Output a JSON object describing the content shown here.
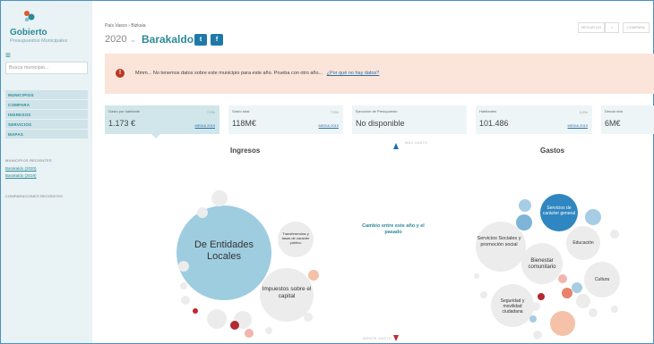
{
  "sidebar": {
    "brand": "Gobierto",
    "brand_sub": "Presupuestos Municipales",
    "search_placeholder": "Busca municipio...",
    "nav": [
      "MUNICIPIOS",
      "COMPARA",
      "INGRESOS",
      "SERVICIOS",
      "MAPAS"
    ],
    "recent_title": "MUNICIPIOS RECIENTES",
    "recent": [
      "Barakaldo (2020)",
      "Barakaldo (2019)"
    ],
    "compare_title": "COMPARACIONES RECIENTES"
  },
  "header": {
    "breadcrumb": "País Vasco › Bizkaia",
    "year": "2020",
    "municipality": "Barakaldo",
    "twitter": "t",
    "facebook": "f",
    "follow_label": "SEGUIR DO",
    "compare_label": "COMPARA"
  },
  "alert": {
    "icon": "!",
    "text": "Mmm... No tenemos datos sobre este municipio para este año. Prueba con otro año...",
    "link": "¿Por qué no hay datos?"
  },
  "stats": [
    {
      "label": "Gasto por habitante",
      "value": "1.173 €",
      "pct": "7,9%",
      "link": "MEDIA 2019"
    },
    {
      "label": "Gasto total",
      "value": "118M€",
      "pct": "7,5%",
      "link": "MEDIA 2019"
    },
    {
      "label": "Ejecución de Presupuesto",
      "value": "No disponible",
      "pct": "",
      "link": ""
    },
    {
      "label": "Habitantes",
      "value": "101.486",
      "pct": "0,6%",
      "link": "MEDIA 2019"
    },
    {
      "label": "Deuda viva",
      "value": "6M€",
      "pct": "",
      "link": ""
    }
  ],
  "charts": {
    "income_title": "Ingresos",
    "expense_title": "Gastos",
    "axis_top": "MÁS GASTO",
    "axis_bottom": "MENOS GASTO",
    "middle_label": "Cambio entre este año y el pasado",
    "income_labels": [
      "De Entidades Locales",
      "Transferencias y tasas de carácter público",
      "Impuestos sobre el capital"
    ],
    "expense_labels": [
      "Servicios de carácter general",
      "Servicios Sociales y promoción social",
      "Educación",
      "Bienestar comunitario",
      "Cultura",
      "Seguridad y movilidad ciudadana"
    ]
  },
  "colors": {
    "accent": "#2b8a99",
    "alert_bg": "#fbe4da",
    "alert_icon": "#b83a1f",
    "link": "#2b6fa8",
    "up": "#1e6fb5",
    "down": "#c0282d"
  }
}
